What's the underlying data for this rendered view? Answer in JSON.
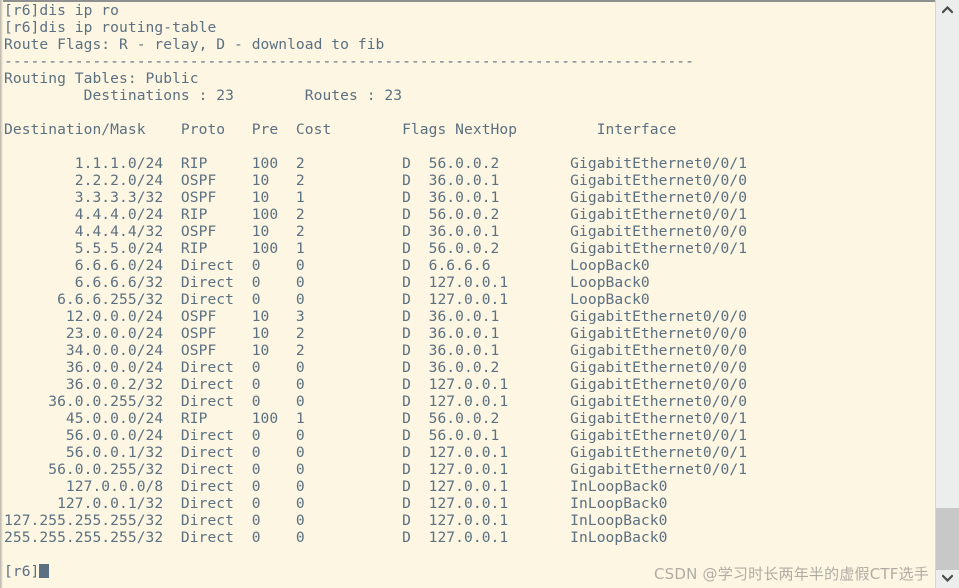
{
  "window": {
    "background_color": "#fdf6e3",
    "text_color": "#5b7081"
  },
  "terminal": {
    "prompt_history": [
      "[r6]dis ip ro",
      "[r6]dis ip routing-table"
    ],
    "route_flags_line": "Route Flags: R - relay, D - download to fib",
    "separator": "------------------------------------------------------------------------------",
    "routing_tables_label": "Routing Tables: Public",
    "summary_line": "         Destinations : 23        Routes : 23",
    "columns": [
      "Destination/Mask",
      "Proto",
      "Pre",
      "Cost",
      "Flags",
      "NextHop",
      "Interface"
    ],
    "header_line": "Destination/Mask    Proto   Pre  Cost        Flags NextHop         Interface",
    "routes": [
      {
        "destination": "1.1.1.0/24",
        "proto": "RIP",
        "pre": "100",
        "cost": "2",
        "flags": "D",
        "nexthop": "56.0.0.2",
        "interface": "GigabitEthernet0/0/1"
      },
      {
        "destination": "2.2.2.0/24",
        "proto": "OSPF",
        "pre": "10",
        "cost": "2",
        "flags": "D",
        "nexthop": "36.0.0.1",
        "interface": "GigabitEthernet0/0/0"
      },
      {
        "destination": "3.3.3.3/32",
        "proto": "OSPF",
        "pre": "10",
        "cost": "1",
        "flags": "D",
        "nexthop": "36.0.0.1",
        "interface": "GigabitEthernet0/0/0"
      },
      {
        "destination": "4.4.4.0/24",
        "proto": "RIP",
        "pre": "100",
        "cost": "2",
        "flags": "D",
        "nexthop": "56.0.0.2",
        "interface": "GigabitEthernet0/0/1"
      },
      {
        "destination": "4.4.4.4/32",
        "proto": "OSPF",
        "pre": "10",
        "cost": "2",
        "flags": "D",
        "nexthop": "36.0.0.1",
        "interface": "GigabitEthernet0/0/0"
      },
      {
        "destination": "5.5.5.0/24",
        "proto": "RIP",
        "pre": "100",
        "cost": "1",
        "flags": "D",
        "nexthop": "56.0.0.2",
        "interface": "GigabitEthernet0/0/1"
      },
      {
        "destination": "6.6.6.0/24",
        "proto": "Direct",
        "pre": "0",
        "cost": "0",
        "flags": "D",
        "nexthop": "6.6.6.6",
        "interface": "LoopBack0"
      },
      {
        "destination": "6.6.6.6/32",
        "proto": "Direct",
        "pre": "0",
        "cost": "0",
        "flags": "D",
        "nexthop": "127.0.0.1",
        "interface": "LoopBack0"
      },
      {
        "destination": "6.6.6.255/32",
        "proto": "Direct",
        "pre": "0",
        "cost": "0",
        "flags": "D",
        "nexthop": "127.0.0.1",
        "interface": "LoopBack0"
      },
      {
        "destination": "12.0.0.0/24",
        "proto": "OSPF",
        "pre": "10",
        "cost": "3",
        "flags": "D",
        "nexthop": "36.0.0.1",
        "interface": "GigabitEthernet0/0/0"
      },
      {
        "destination": "23.0.0.0/24",
        "proto": "OSPF",
        "pre": "10",
        "cost": "2",
        "flags": "D",
        "nexthop": "36.0.0.1",
        "interface": "GigabitEthernet0/0/0"
      },
      {
        "destination": "34.0.0.0/24",
        "proto": "OSPF",
        "pre": "10",
        "cost": "2",
        "flags": "D",
        "nexthop": "36.0.0.1",
        "interface": "GigabitEthernet0/0/0"
      },
      {
        "destination": "36.0.0.0/24",
        "proto": "Direct",
        "pre": "0",
        "cost": "0",
        "flags": "D",
        "nexthop": "36.0.0.2",
        "interface": "GigabitEthernet0/0/0"
      },
      {
        "destination": "36.0.0.2/32",
        "proto": "Direct",
        "pre": "0",
        "cost": "0",
        "flags": "D",
        "nexthop": "127.0.0.1",
        "interface": "GigabitEthernet0/0/0"
      },
      {
        "destination": "36.0.0.255/32",
        "proto": "Direct",
        "pre": "0",
        "cost": "0",
        "flags": "D",
        "nexthop": "127.0.0.1",
        "interface": "GigabitEthernet0/0/0"
      },
      {
        "destination": "45.0.0.0/24",
        "proto": "RIP",
        "pre": "100",
        "cost": "1",
        "flags": "D",
        "nexthop": "56.0.0.2",
        "interface": "GigabitEthernet0/0/1"
      },
      {
        "destination": "56.0.0.0/24",
        "proto": "Direct",
        "pre": "0",
        "cost": "0",
        "flags": "D",
        "nexthop": "56.0.0.1",
        "interface": "GigabitEthernet0/0/1"
      },
      {
        "destination": "56.0.0.1/32",
        "proto": "Direct",
        "pre": "0",
        "cost": "0",
        "flags": "D",
        "nexthop": "127.0.0.1",
        "interface": "GigabitEthernet0/0/1"
      },
      {
        "destination": "56.0.0.255/32",
        "proto": "Direct",
        "pre": "0",
        "cost": "0",
        "flags": "D",
        "nexthop": "127.0.0.1",
        "interface": "GigabitEthernet0/0/1"
      },
      {
        "destination": "127.0.0.0/8",
        "proto": "Direct",
        "pre": "0",
        "cost": "0",
        "flags": "D",
        "nexthop": "127.0.0.1",
        "interface": "InLoopBack0"
      },
      {
        "destination": "127.0.0.1/32",
        "proto": "Direct",
        "pre": "0",
        "cost": "0",
        "flags": "D",
        "nexthop": "127.0.0.1",
        "interface": "InLoopBack0"
      },
      {
        "destination": "127.255.255.255/32",
        "proto": "Direct",
        "pre": "0",
        "cost": "0",
        "flags": "D",
        "nexthop": "127.0.0.1",
        "interface": "InLoopBack0"
      },
      {
        "destination": "255.255.255.255/32",
        "proto": "Direct",
        "pre": "0",
        "cost": "0",
        "flags": "D",
        "nexthop": "127.0.0.1",
        "interface": "InLoopBack0"
      }
    ],
    "final_prompt": "[r6]"
  },
  "watermark": {
    "text": "CSDN @学习时长两年半的虚假CTF选手"
  },
  "scrollbar": {
    "up_arrow": "chevron-up-icon",
    "down_arrow": "chevron-down-icon"
  }
}
